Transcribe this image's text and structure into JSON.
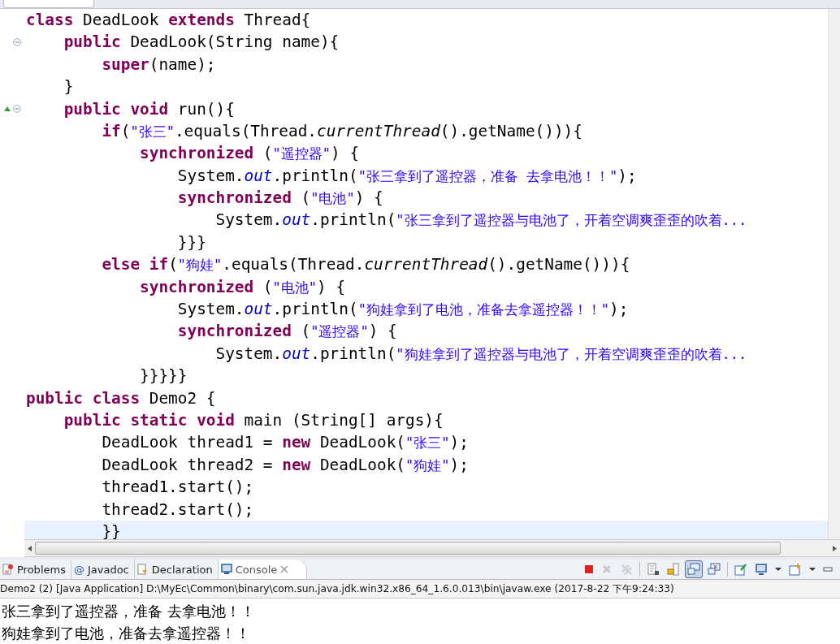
{
  "editor": {
    "lines": [
      {
        "fold": false,
        "override": false,
        "current": false,
        "tokens": [
          {
            "kind": "kw",
            "text": "class"
          },
          {
            "kind": "plain",
            "text": " DeadLook "
          },
          {
            "kind": "kw",
            "text": "extends"
          },
          {
            "kind": "plain",
            "text": " Thread{"
          }
        ]
      },
      {
        "fold": true,
        "override": false,
        "current": false,
        "tokens": [
          {
            "kind": "kw",
            "text": "    public"
          },
          {
            "kind": "plain",
            "text": " DeadLook(String name){"
          }
        ]
      },
      {
        "fold": false,
        "override": false,
        "current": false,
        "tokens": [
          {
            "kind": "kw",
            "text": "        super"
          },
          {
            "kind": "plain",
            "text": "(name);"
          }
        ]
      },
      {
        "fold": false,
        "override": false,
        "current": false,
        "tokens": [
          {
            "kind": "plain",
            "text": "    }"
          }
        ]
      },
      {
        "fold": true,
        "override": true,
        "current": false,
        "tokens": [
          {
            "kind": "kw",
            "text": "    public void"
          },
          {
            "kind": "plain",
            "text": " run(){"
          }
        ]
      },
      {
        "fold": false,
        "override": false,
        "current": false,
        "tokens": [
          {
            "kind": "kw",
            "text": "        if"
          },
          {
            "kind": "plain",
            "text": "("
          },
          {
            "kind": "str",
            "text": "\"张三\""
          },
          {
            "kind": "plain",
            "text": ".equals(Thread."
          },
          {
            "kind": "static",
            "text": "currentThread"
          },
          {
            "kind": "plain",
            "text": "().getName())){"
          }
        ]
      },
      {
        "fold": false,
        "override": false,
        "current": false,
        "tokens": [
          {
            "kind": "kw",
            "text": "            synchronized"
          },
          {
            "kind": "plain",
            "text": " ("
          },
          {
            "kind": "str",
            "text": "\"遥控器\""
          },
          {
            "kind": "plain",
            "text": ") {"
          }
        ]
      },
      {
        "fold": false,
        "override": false,
        "current": false,
        "tokens": [
          {
            "kind": "plain",
            "text": "                System."
          },
          {
            "kind": "field",
            "text": "out"
          },
          {
            "kind": "plain",
            "text": ".println("
          },
          {
            "kind": "str",
            "text": "\"张三拿到了遥控器，准备 去拿电池！！\""
          },
          {
            "kind": "plain",
            "text": ");"
          }
        ]
      },
      {
        "fold": false,
        "override": false,
        "current": false,
        "tokens": [
          {
            "kind": "kw",
            "text": "                synchronized"
          },
          {
            "kind": "plain",
            "text": " ("
          },
          {
            "kind": "str",
            "text": "\"电池\""
          },
          {
            "kind": "plain",
            "text": ") {"
          }
        ]
      },
      {
        "fold": false,
        "override": false,
        "current": false,
        "tokens": [
          {
            "kind": "plain",
            "text": "                    System."
          },
          {
            "kind": "field",
            "text": "out"
          },
          {
            "kind": "plain",
            "text": ".println("
          },
          {
            "kind": "str",
            "text": "\"张三拿到了遥控器与电池了，开着空调爽歪歪的吹着..."
          }
        ]
      },
      {
        "fold": false,
        "override": false,
        "current": false,
        "tokens": [
          {
            "kind": "plain",
            "text": "                }}}"
          }
        ]
      },
      {
        "fold": false,
        "override": false,
        "current": false,
        "tokens": [
          {
            "kind": "kw",
            "text": "        else if"
          },
          {
            "kind": "plain",
            "text": "("
          },
          {
            "kind": "str",
            "text": "\"狗娃\""
          },
          {
            "kind": "plain",
            "text": ".equals(Thread."
          },
          {
            "kind": "static",
            "text": "currentThread"
          },
          {
            "kind": "plain",
            "text": "().getName())){"
          }
        ]
      },
      {
        "fold": false,
        "override": false,
        "current": false,
        "tokens": [
          {
            "kind": "kw",
            "text": "            synchronized"
          },
          {
            "kind": "plain",
            "text": " ("
          },
          {
            "kind": "str",
            "text": "\"电池\""
          },
          {
            "kind": "plain",
            "text": ") {"
          }
        ]
      },
      {
        "fold": false,
        "override": false,
        "current": false,
        "tokens": [
          {
            "kind": "plain",
            "text": "                System."
          },
          {
            "kind": "field",
            "text": "out"
          },
          {
            "kind": "plain",
            "text": ".println("
          },
          {
            "kind": "str",
            "text": "\"狗娃拿到了电池，准备去拿遥控器！！\""
          },
          {
            "kind": "plain",
            "text": ");"
          }
        ]
      },
      {
        "fold": false,
        "override": false,
        "current": false,
        "tokens": [
          {
            "kind": "kw",
            "text": "                synchronized"
          },
          {
            "kind": "plain",
            "text": " ("
          },
          {
            "kind": "str",
            "text": "\"遥控器\""
          },
          {
            "kind": "plain",
            "text": ") {"
          }
        ]
      },
      {
        "fold": false,
        "override": false,
        "current": false,
        "tokens": [
          {
            "kind": "plain",
            "text": "                    System."
          },
          {
            "kind": "field",
            "text": "out"
          },
          {
            "kind": "plain",
            "text": ".println("
          },
          {
            "kind": "str",
            "text": "\"狗娃拿到了遥控器与电池了，开着空调爽歪歪的吹着..."
          }
        ]
      },
      {
        "fold": false,
        "override": false,
        "current": false,
        "tokens": [
          {
            "kind": "plain",
            "text": "            }}}}}"
          }
        ]
      },
      {
        "fold": false,
        "override": false,
        "current": false,
        "tokens": [
          {
            "kind": "kw",
            "text": "public class"
          },
          {
            "kind": "plain",
            "text": " Demo2 {"
          }
        ]
      },
      {
        "fold": false,
        "override": false,
        "current": false,
        "tokens": [
          {
            "kind": "kw",
            "text": "    public static void"
          },
          {
            "kind": "plain",
            "text": " main (String[] args){"
          }
        ]
      },
      {
        "fold": false,
        "override": false,
        "current": false,
        "tokens": [
          {
            "kind": "plain",
            "text": "        DeadLook thread1 = "
          },
          {
            "kind": "kw",
            "text": "new"
          },
          {
            "kind": "plain",
            "text": " DeadLook("
          },
          {
            "kind": "str",
            "text": "\"张三\""
          },
          {
            "kind": "plain",
            "text": ");"
          }
        ]
      },
      {
        "fold": false,
        "override": false,
        "current": false,
        "tokens": [
          {
            "kind": "plain",
            "text": "        DeadLook thread2 = "
          },
          {
            "kind": "kw",
            "text": "new"
          },
          {
            "kind": "plain",
            "text": " DeadLook("
          },
          {
            "kind": "str",
            "text": "\"狗娃\""
          },
          {
            "kind": "plain",
            "text": ");"
          }
        ]
      },
      {
        "fold": false,
        "override": false,
        "current": false,
        "tokens": [
          {
            "kind": "plain",
            "text": "        thread1.start();"
          }
        ]
      },
      {
        "fold": false,
        "override": false,
        "current": false,
        "tokens": [
          {
            "kind": "plain",
            "text": "        thread2.start();"
          }
        ]
      },
      {
        "fold": false,
        "override": false,
        "current": true,
        "tokens": [
          {
            "kind": "plain",
            "text": "        }}"
          }
        ]
      }
    ]
  },
  "console": {
    "tabs": [
      {
        "kind": "problems",
        "label": "Problems",
        "selected": false
      },
      {
        "kind": "javadoc",
        "symbol": "@",
        "label": "Javadoc",
        "selected": false
      },
      {
        "kind": "declaration",
        "label": "Declaration",
        "selected": false
      },
      {
        "kind": "console",
        "label": "Console",
        "selected": true
      }
    ],
    "toolbar": [
      {
        "kind": "terminate",
        "selected": false,
        "disabled": false
      },
      {
        "kind": "remove",
        "selected": false,
        "disabled": true
      },
      {
        "kind": "remove-all",
        "selected": false,
        "disabled": true
      },
      {
        "kind": "separator"
      },
      {
        "kind": "clear",
        "selected": false,
        "disabled": false
      },
      {
        "kind": "scroll-lock",
        "selected": false,
        "disabled": false
      },
      {
        "kind": "word-wrap",
        "selected": true,
        "disabled": false
      },
      {
        "kind": "show-output",
        "selected": false,
        "disabled": false
      },
      {
        "kind": "separator"
      },
      {
        "kind": "pin",
        "selected": false,
        "disabled": false
      },
      {
        "kind": "display",
        "selected": false,
        "disabled": false
      },
      {
        "kind": "dropdown",
        "selected": false,
        "disabled": false
      },
      {
        "kind": "open",
        "selected": false,
        "disabled": false
      },
      {
        "kind": "dropdown",
        "selected": false,
        "disabled": false
      },
      {
        "kind": "minimize",
        "selected": false,
        "disabled": false
      }
    ],
    "process": "Demo2 (2) [Java Application] D:\\MyEc\\Common\\binary\\com.sun.java.jdk.win32.x86_64_1.6.0.013\\bin\\javaw.exe (2017-8-22 下午9:24:33)",
    "output": [
      "张三拿到了遥控器，准备 去拿电池！！",
      "狗娃拿到了电池，准备去拿遥控器！！"
    ]
  }
}
